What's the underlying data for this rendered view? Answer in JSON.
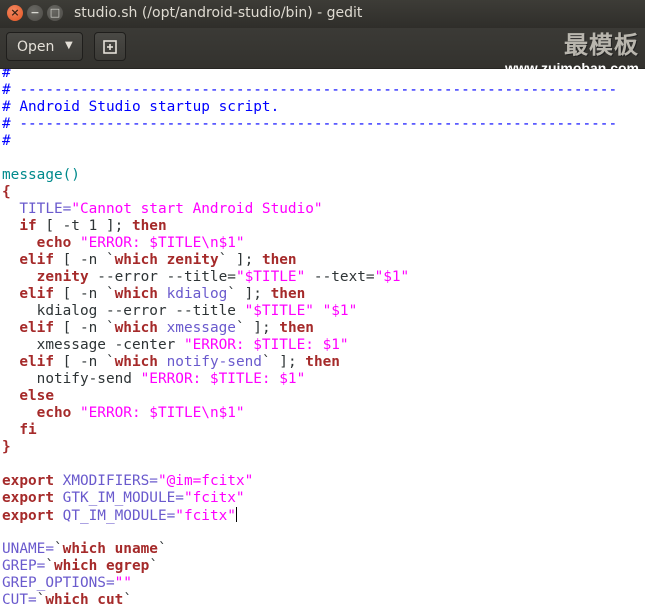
{
  "window": {
    "title": "studio.sh (/opt/android-studio/bin) - gedit",
    "close_glyph": "×",
    "minimize_glyph": "−",
    "maximize_glyph": "□"
  },
  "toolbar": {
    "open_label": "Open",
    "open_arrow": "▼",
    "new_document_icon": "new-document-icon"
  },
  "watermark": {
    "chinese": "最模板",
    "url": "www.zuimoban.com"
  },
  "colors": {
    "comment": "#0000ff",
    "keyword": "#a52a2a",
    "string": "#ff00ff",
    "variable": "#6a5acd",
    "function": "#008a8c",
    "titlebar": "#3d3c37"
  },
  "editor": {
    "lines": [
      [
        [
          "comment",
          "#"
        ]
      ],
      [
        [
          "comment",
          "# ---------------------------------------------------------------------"
        ]
      ],
      [
        [
          "comment",
          "# Android Studio startup script."
        ]
      ],
      [
        [
          "comment",
          "# ---------------------------------------------------------------------"
        ]
      ],
      [
        [
          "comment",
          "#"
        ]
      ],
      [],
      [
        [
          "func",
          "message()"
        ]
      ],
      [
        [
          "kw",
          "{"
        ]
      ],
      [
        [
          "plain",
          "  "
        ],
        [
          "var",
          "TITLE="
        ],
        [
          "str",
          "\"Cannot start Android Studio\""
        ]
      ],
      [
        [
          "plain",
          "  "
        ],
        [
          "kw",
          "if"
        ],
        [
          "plain",
          " [ -t 1 ]; "
        ],
        [
          "kw",
          "then"
        ]
      ],
      [
        [
          "plain",
          "    "
        ],
        [
          "kw",
          "echo"
        ],
        [
          "plain",
          " "
        ],
        [
          "str",
          "\"ERROR: $TITLE\\n$1\""
        ]
      ],
      [
        [
          "plain",
          "  "
        ],
        [
          "kw",
          "elif"
        ],
        [
          "plain",
          " [ -n `"
        ],
        [
          "kw",
          "which zenity"
        ],
        [
          "plain",
          "` ]; "
        ],
        [
          "kw",
          "then"
        ]
      ],
      [
        [
          "plain",
          "    "
        ],
        [
          "kw",
          "zenity"
        ],
        [
          "plain",
          " --error --title="
        ],
        [
          "str",
          "\"$TITLE\""
        ],
        [
          "plain",
          " --text="
        ],
        [
          "str",
          "\"$1\""
        ]
      ],
      [
        [
          "plain",
          "  "
        ],
        [
          "kw",
          "elif"
        ],
        [
          "plain",
          " [ -n `"
        ],
        [
          "kw",
          "which"
        ],
        [
          "plain",
          " "
        ],
        [
          "var",
          "kdialog"
        ],
        [
          "plain",
          "` ]; "
        ],
        [
          "kw",
          "then"
        ]
      ],
      [
        [
          "plain",
          "    kdialog --error --title "
        ],
        [
          "str",
          "\"$TITLE\""
        ],
        [
          "plain",
          " "
        ],
        [
          "str",
          "\"$1\""
        ]
      ],
      [
        [
          "plain",
          "  "
        ],
        [
          "kw",
          "elif"
        ],
        [
          "plain",
          " [ -n `"
        ],
        [
          "kw",
          "which"
        ],
        [
          "plain",
          " "
        ],
        [
          "var",
          "xmessage"
        ],
        [
          "plain",
          "` ]; "
        ],
        [
          "kw",
          "then"
        ]
      ],
      [
        [
          "plain",
          "    xmessage -center "
        ],
        [
          "str",
          "\"ERROR: $TITLE: $1\""
        ]
      ],
      [
        [
          "plain",
          "  "
        ],
        [
          "kw",
          "elif"
        ],
        [
          "plain",
          " [ -n `"
        ],
        [
          "kw",
          "which"
        ],
        [
          "plain",
          " "
        ],
        [
          "var",
          "notify-send"
        ],
        [
          "plain",
          "` ]; "
        ],
        [
          "kw",
          "then"
        ]
      ],
      [
        [
          "plain",
          "    notify-send "
        ],
        [
          "str",
          "\"ERROR: $TITLE: $1\""
        ]
      ],
      [
        [
          "plain",
          "  "
        ],
        [
          "kw",
          "else"
        ]
      ],
      [
        [
          "plain",
          "    "
        ],
        [
          "kw",
          "echo"
        ],
        [
          "plain",
          " "
        ],
        [
          "str",
          "\"ERROR: $TITLE\\n$1\""
        ]
      ],
      [
        [
          "plain",
          "  "
        ],
        [
          "kw",
          "fi"
        ]
      ],
      [
        [
          "kw",
          "}"
        ]
      ],
      [],
      [
        [
          "kw",
          "export"
        ],
        [
          "plain",
          " "
        ],
        [
          "var",
          "XMODIFIERS="
        ],
        [
          "str",
          "\"@im=fcitx\""
        ]
      ],
      [
        [
          "kw",
          "export"
        ],
        [
          "plain",
          " "
        ],
        [
          "var",
          "GTK_IM_MODULE="
        ],
        [
          "str",
          "\"fcitx\""
        ]
      ],
      [
        [
          "kw",
          "export"
        ],
        [
          "plain",
          " "
        ],
        [
          "var",
          "QT_IM_MODULE="
        ],
        [
          "str",
          "\"fcitx\""
        ],
        [
          "caret",
          ""
        ]
      ],
      [],
      [
        [
          "var",
          "UNAME="
        ],
        [
          "plain",
          "`"
        ],
        [
          "kw",
          "which uname"
        ],
        [
          "plain",
          "`"
        ]
      ],
      [
        [
          "var",
          "GREP="
        ],
        [
          "plain",
          "`"
        ],
        [
          "kw",
          "which egrep"
        ],
        [
          "plain",
          "`"
        ]
      ],
      [
        [
          "var",
          "GREP_OPTIONS="
        ],
        [
          "str",
          "\"\""
        ]
      ],
      [
        [
          "var",
          "CUT="
        ],
        [
          "plain",
          "`"
        ],
        [
          "kw",
          "which cut"
        ],
        [
          "plain",
          "`"
        ]
      ]
    ]
  }
}
